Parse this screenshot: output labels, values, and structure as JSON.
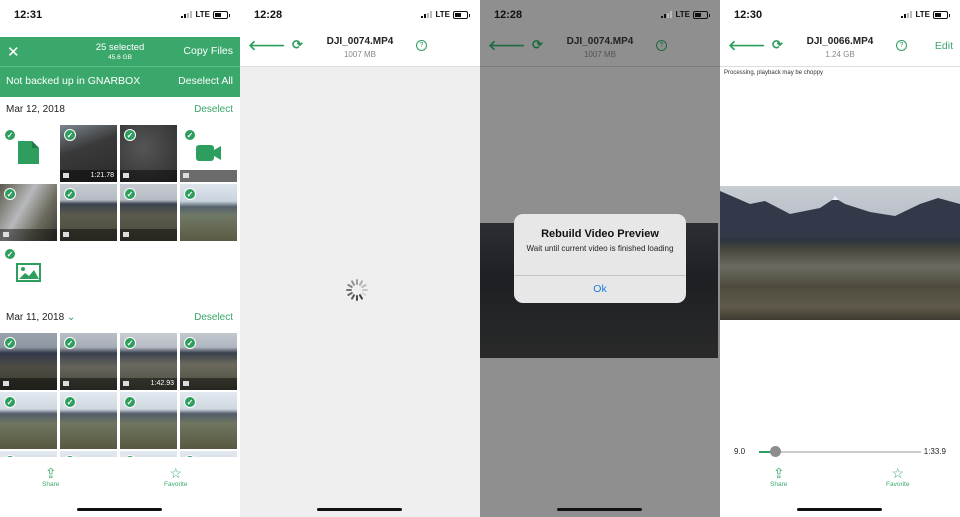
{
  "status_bars": [
    {
      "time": "12:31",
      "network": "LTE"
    },
    {
      "time": "12:28",
      "network": "LTE"
    },
    {
      "time": "12:28",
      "network": "LTE"
    },
    {
      "time": "12:30",
      "network": "LTE"
    }
  ],
  "screen1": {
    "selection": {
      "count_label": "25 selected",
      "size_label": "45.6 GB",
      "close_icon": "close-icon",
      "copy_label": "Copy Files",
      "filter_label": "Not backed up in GNARBOX",
      "deselect_all_label": "Deselect All"
    },
    "groups": [
      {
        "date": "Mar 12, 2018",
        "deselect_label": "Deselect",
        "items": [
          {
            "type": "document",
            "icon": "document-icon",
            "selected": true
          },
          {
            "type": "video",
            "duration": "1:21.78",
            "selected": true
          },
          {
            "type": "video",
            "duration": "",
            "selected": true
          },
          {
            "type": "video-placeholder",
            "icon": "video-camera-icon",
            "selected": true
          },
          {
            "type": "video",
            "duration": "",
            "selected": true
          },
          {
            "type": "video",
            "duration": "",
            "selected": true
          },
          {
            "type": "video",
            "duration": "",
            "selected": true
          },
          {
            "type": "photo",
            "selected": true
          },
          {
            "type": "image-placeholder",
            "icon": "image-icon",
            "selected": true
          }
        ]
      },
      {
        "date": "Mar 11, 2018",
        "deselect_label": "Deselect",
        "items": [
          {
            "type": "video",
            "duration": "",
            "selected": true
          },
          {
            "type": "video",
            "duration": "",
            "selected": true
          },
          {
            "type": "video",
            "duration": "1:42.93",
            "selected": true
          },
          {
            "type": "video",
            "duration": "",
            "selected": true
          },
          {
            "type": "photo",
            "selected": true
          },
          {
            "type": "photo",
            "selected": true
          },
          {
            "type": "photo",
            "selected": true
          },
          {
            "type": "photo",
            "selected": true
          }
        ]
      }
    ],
    "toolbar": {
      "share_label": "Share",
      "favorite_label": "Favorite"
    }
  },
  "screen2": {
    "title": "DJI_0074.MP4",
    "subtitle": "1007 MB",
    "state": "loading"
  },
  "screen3": {
    "title": "DJI_0074.MP4",
    "subtitle": "1007 MB",
    "alert": {
      "title": "Rebuild Video Preview",
      "message": "Wait until current video is finished loading",
      "ok_label": "Ok"
    }
  },
  "screen4": {
    "title": "DJI_0066.MP4",
    "subtitle": "1.24 GB",
    "edit_label": "Edit",
    "notice": "Processing, playback may be choppy",
    "scrubber": {
      "current": "9.0",
      "end": "1:33.9",
      "progress": 0.1
    },
    "toolbar": {
      "share_label": "Share",
      "favorite_label": "Favorite"
    }
  },
  "colors": {
    "accent": "#3aa86b",
    "alert_button": "#1a7ee0"
  }
}
